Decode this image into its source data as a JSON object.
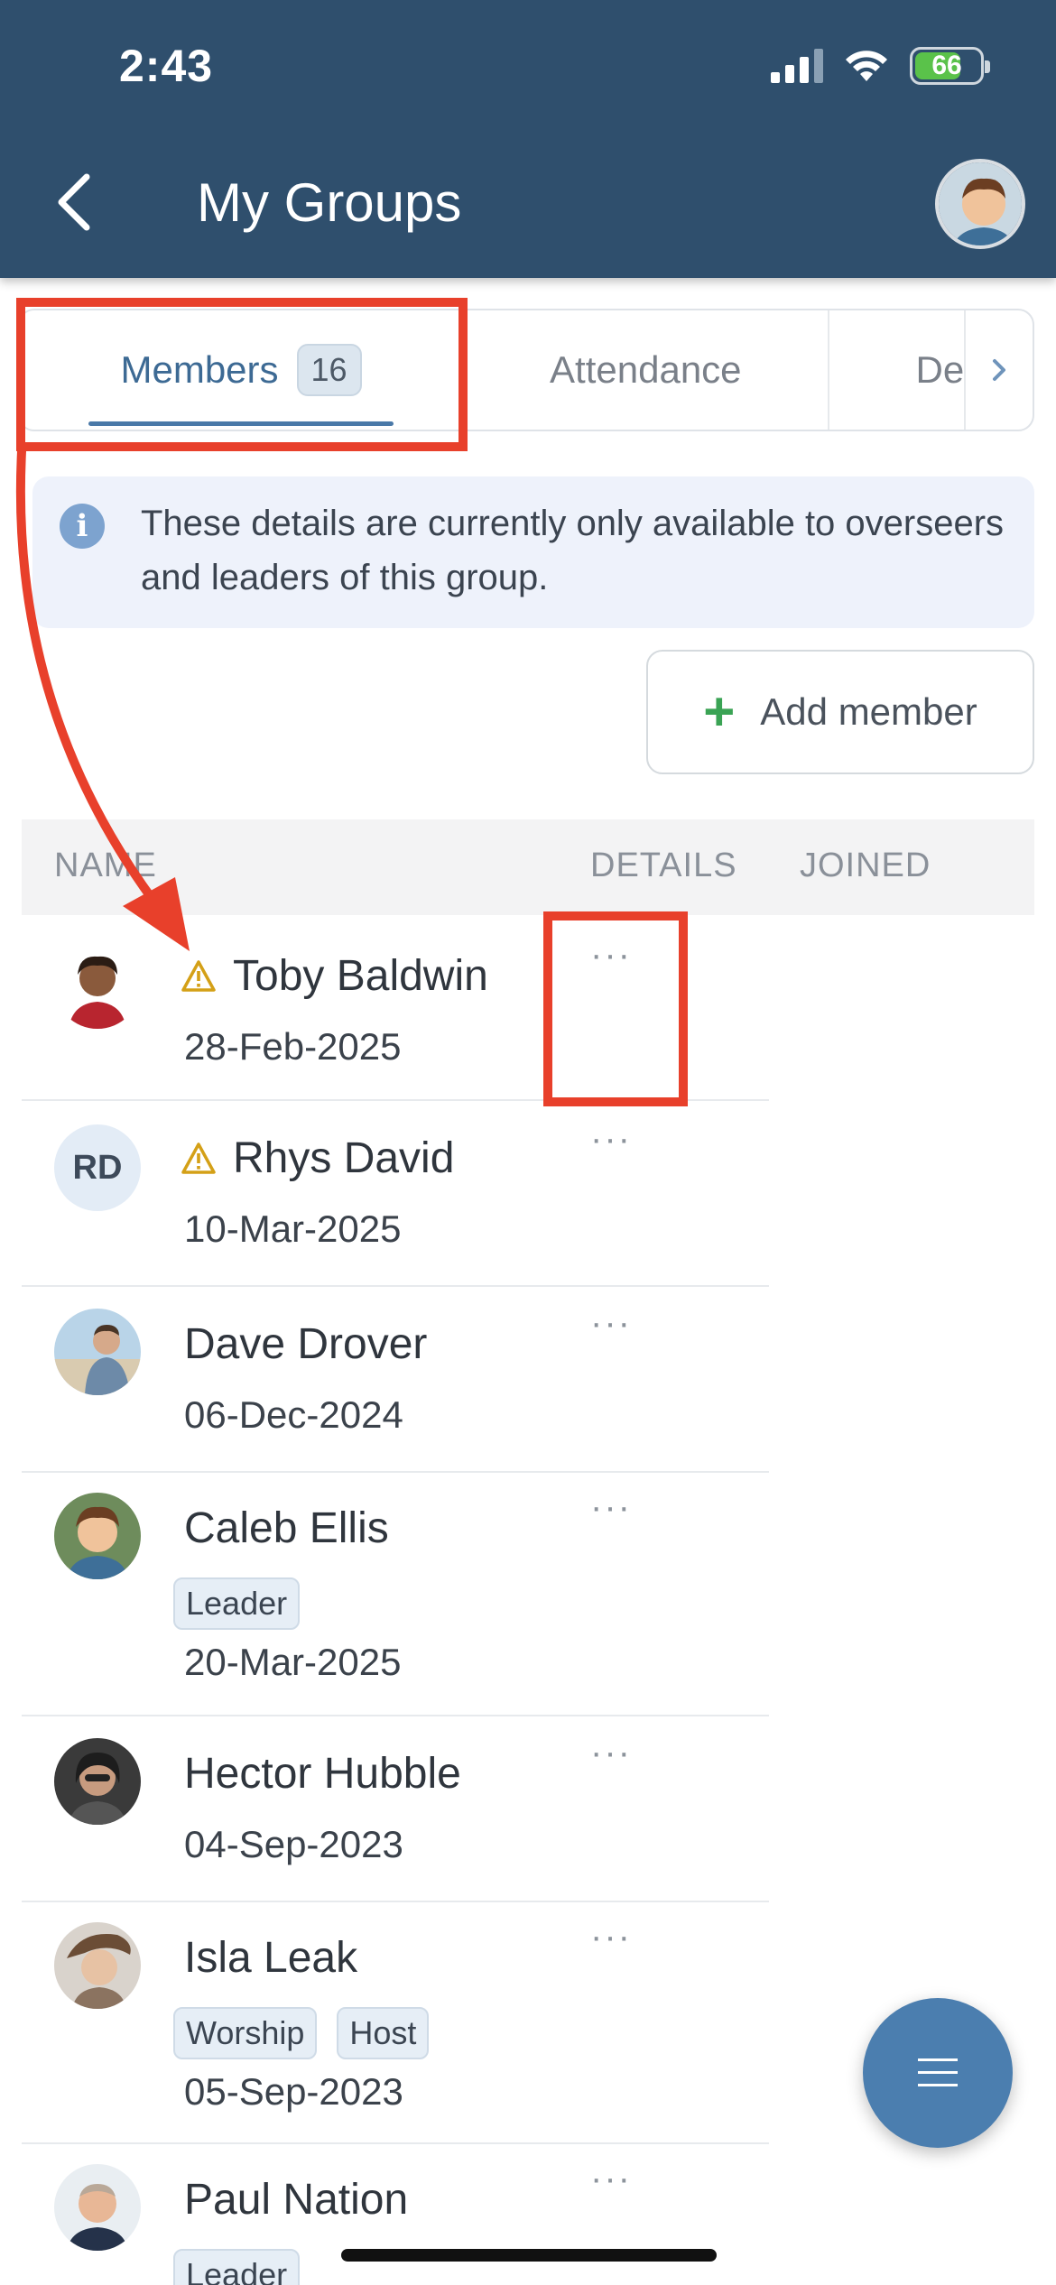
{
  "status_bar": {
    "time": "2:43",
    "battery": "66"
  },
  "header": {
    "title": "My Groups"
  },
  "tabs": [
    {
      "label": "Members",
      "count": "16"
    },
    {
      "label": "Attendance"
    },
    {
      "label": "De"
    }
  ],
  "info": {
    "text": "These details are currently only available to overseers and leaders of this group."
  },
  "add_member": {
    "label": "Add member"
  },
  "table": {
    "columns": [
      "NAME",
      "DETAILS",
      "JOINED"
    ],
    "more": "···",
    "rows": [
      {
        "name": "Toby Baldwin",
        "date": "28-Feb-2025",
        "warning": true,
        "tags": []
      },
      {
        "name": "Rhys David",
        "initials": "RD",
        "date": "10-Mar-2025",
        "warning": true,
        "tags": []
      },
      {
        "name": "Dave Drover",
        "date": "06-Dec-2024",
        "warning": false,
        "tags": []
      },
      {
        "name": "Caleb Ellis",
        "date": "20-Mar-2025",
        "warning": false,
        "tags": [
          "Leader"
        ]
      },
      {
        "name": "Hector Hubble",
        "date": "04-Sep-2023",
        "warning": false,
        "tags": []
      },
      {
        "name": "Isla Leak",
        "date": "05-Sep-2023",
        "warning": false,
        "tags": [
          "Worship",
          "Host"
        ]
      },
      {
        "name": "Paul Nation",
        "date": "",
        "warning": false,
        "tags": [
          "Leader"
        ]
      }
    ]
  },
  "colors": {
    "header": "#2f4f6d",
    "accent": "#4a79a8",
    "annotation": "#e8402b",
    "warning": "#d4a017",
    "add": "#3aa354"
  }
}
